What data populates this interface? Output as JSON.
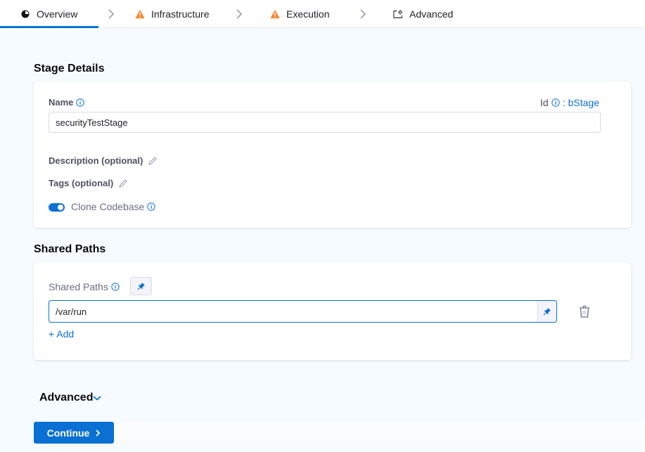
{
  "tabs": [
    {
      "label": "Overview",
      "icon": "overview-icon",
      "active": true,
      "warning": false
    },
    {
      "label": "Infrastructure",
      "icon": "warning-icon",
      "active": false,
      "warning": true
    },
    {
      "label": "Execution",
      "icon": "warning-icon",
      "active": false,
      "warning": true
    },
    {
      "label": "Advanced",
      "icon": "advanced-settings-icon",
      "active": false,
      "warning": false
    }
  ],
  "colors": {
    "accent": "#0b70d3",
    "warning": "#ff832b",
    "background": "#f6fbff"
  },
  "stage_details": {
    "title": "Stage Details",
    "name_label": "Name",
    "name_value": "securityTestStage",
    "id_label": "Id",
    "id_separator": ":",
    "id_value": "bStage",
    "description_label": "Description (optional)",
    "tags_label": "Tags (optional)",
    "clone_codebase_label": "Clone Codebase",
    "clone_codebase_enabled": true
  },
  "shared_paths": {
    "title": "Shared Paths",
    "field_label": "Shared Paths",
    "paths": [
      "/var/run"
    ],
    "add_label": "+ Add"
  },
  "advanced": {
    "label": "Advanced"
  },
  "continue_button": {
    "label": "Continue"
  }
}
